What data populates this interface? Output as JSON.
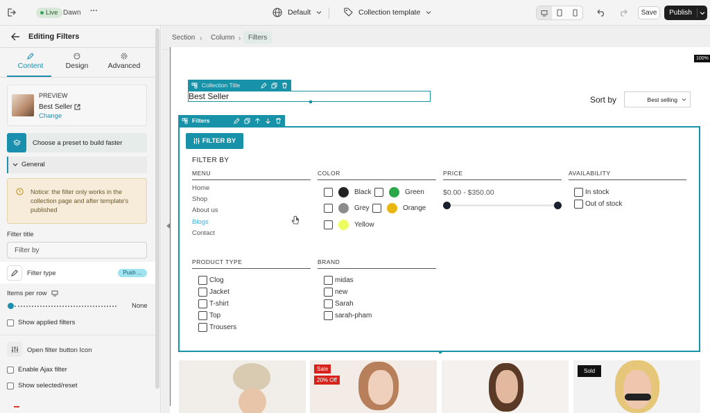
{
  "topbar": {
    "live_label": "Live",
    "theme_name": "Dawn",
    "more_label": "···",
    "device_preset": "Default",
    "template_name": "Collection template",
    "save_label": "Save",
    "publish_label": "Publish",
    "zoom": "100%"
  },
  "panel": {
    "title": "Editing Filters",
    "tabs": [
      {
        "label": "Content",
        "active": true
      },
      {
        "label": "Design",
        "active": false
      },
      {
        "label": "Advanced",
        "active": false
      }
    ],
    "preview": {
      "heading": "PREVIEW",
      "name": "Best Seller",
      "change_label": "Change"
    },
    "preset_label": "Choose a preset to build faster",
    "general_label": "General",
    "notice": "Notice: the filter only works in the collection page and after template's published",
    "filter_title_label": "Filter title",
    "filter_title_value": "Filter by",
    "filter_type_label": "Filter type",
    "filter_type_value": "Push ...",
    "items_per_row_label": "Items per row",
    "items_per_row_value": "None",
    "show_applied_label": "Show applied filters",
    "open_icon_label": "Open filter button Icon",
    "ajax_label": "Enable Ajax filter",
    "show_selected_label": "Show selected/reset"
  },
  "breadcrumb": [
    "Section",
    "Column",
    "Filters"
  ],
  "collection": {
    "toolbar_label": "Collection Title",
    "title": "Best Seller",
    "sort_label": "Sort by",
    "sort_value": "Best selling"
  },
  "filters": {
    "toolbar_label": "Filters",
    "button_label": "FILTER BY",
    "heading": "FILTER BY",
    "menu": {
      "title": "MENU",
      "items": [
        "Home",
        "Shop",
        "About us",
        "Blogs",
        "Contact"
      ],
      "active_index": 3
    },
    "color": {
      "title": "COLOR",
      "options": [
        {
          "label": "Black",
          "color": "#222222"
        },
        {
          "label": "Green",
          "color": "#2aa84a"
        },
        {
          "label": "Grey",
          "color": "#8c8c8c"
        },
        {
          "label": "Orange",
          "color": "#e9b60f"
        },
        {
          "label": "Yellow",
          "color": "#eefc5f"
        }
      ]
    },
    "price": {
      "title": "PRICE",
      "range": "$0.00 - $350.00"
    },
    "availability": {
      "title": "AVAILABILITY",
      "options": [
        "In stock",
        "Out of stock"
      ]
    },
    "product_type": {
      "title": "PRODUCT TYPE",
      "options": [
        "Clog",
        "Jacket",
        "T-shirt",
        "Top",
        "Trousers"
      ]
    },
    "brand": {
      "title": "BRAND",
      "options": [
        "midas",
        "new",
        "Sarah",
        "sarah-pham"
      ]
    }
  },
  "products": [
    {
      "badges": []
    },
    {
      "badges": [
        "Sale",
        "20% Off"
      ]
    },
    {
      "badges": []
    },
    {
      "badges": [
        "Sold"
      ]
    }
  ],
  "colors": {
    "accent": "#1792a8",
    "sale": "#d8231c",
    "sold": "#111111"
  }
}
